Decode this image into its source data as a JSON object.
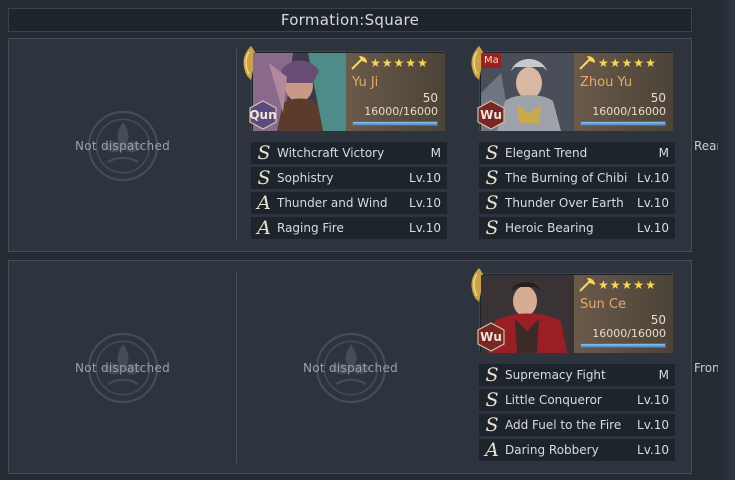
{
  "formation": {
    "title": "Formation:Square"
  },
  "rows": {
    "rear_label": "Rear",
    "front_label": "Front"
  },
  "empty_text": "Not dispatched",
  "colors": {
    "background": "#252b33",
    "panel": "#2d343d",
    "hero_name": "#e8a968",
    "hp_fill": "#4a8cc7",
    "faction_qun": "#5a4a82",
    "faction_wu": "#7a2626"
  },
  "heroes": {
    "yu_ji": {
      "name": "Yu Ji",
      "stars": 5,
      "level": "50",
      "hp": "16000/16000",
      "hp_fraction": 1.0,
      "faction": "Qun",
      "skills": [
        {
          "grade": "S",
          "name": "Witchcraft Victory",
          "level": "M"
        },
        {
          "grade": "S",
          "name": "Sophistry",
          "level": "Lv.10"
        },
        {
          "grade": "A",
          "name": "Thunder and Wind",
          "level": "Lv.10"
        },
        {
          "grade": "A",
          "name": "Raging Fire",
          "level": "Lv.10"
        }
      ]
    },
    "zhou_yu": {
      "name": "Zhou Yu",
      "stars": 5,
      "level": "50",
      "hp": "16000/16000",
      "hp_fraction": 1.0,
      "faction": "Wu",
      "tag": "Ma",
      "skills": [
        {
          "grade": "S",
          "name": "Elegant Trend",
          "level": "M"
        },
        {
          "grade": "S",
          "name": "The Burning of Chibi",
          "level": "Lv.10"
        },
        {
          "grade": "S",
          "name": "Thunder Over Earth",
          "level": "Lv.10"
        },
        {
          "grade": "S",
          "name": "Heroic Bearing",
          "level": "Lv.10"
        }
      ]
    },
    "sun_ce": {
      "name": "Sun Ce",
      "stars": 5,
      "level": "50",
      "hp": "16000/16000",
      "hp_fraction": 1.0,
      "faction": "Wu",
      "skills": [
        {
          "grade": "S",
          "name": "Supremacy Fight",
          "level": "M"
        },
        {
          "grade": "S",
          "name": "Little Conqueror",
          "level": "Lv.10"
        },
        {
          "grade": "S",
          "name": "Add Fuel to the Fire",
          "level": "Lv.10"
        },
        {
          "grade": "A",
          "name": "Daring Robbery",
          "level": "Lv.10"
        }
      ]
    }
  },
  "icons": [
    "wing-emblem-icon",
    "axe-icon",
    "star-icon",
    "faction-hexagon-icon",
    "lotus-emblem-icon"
  ]
}
